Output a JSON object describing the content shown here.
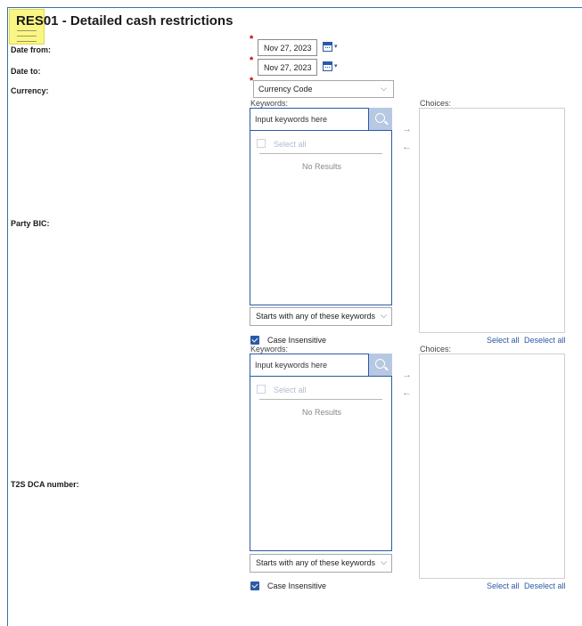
{
  "page": {
    "title": "RES01 - Detailed cash restrictions"
  },
  "fields": {
    "date_from": {
      "label": "Date from:",
      "value": "Nov 27, 2023",
      "required": "*"
    },
    "date_to": {
      "label": "Date to:",
      "value": "Nov 27, 2023",
      "required": "*"
    },
    "currency": {
      "label": "Currency:",
      "value": "Currency Code",
      "required": "*"
    }
  },
  "party_bic": {
    "label": "Party BIC:",
    "keywords_label": "Keywords:",
    "choices_label": "Choices:",
    "search_placeholder": "Input keywords here",
    "select_all_item": "Select all",
    "no_results": "No Results",
    "match_mode": "Starts with any of these keywords",
    "case_insensitive": "Case Insensitive",
    "select_all_link": "Select all",
    "deselect_all_link": "Deselect all",
    "arrow_right": "→",
    "arrow_left": "←"
  },
  "t2s_dca": {
    "label": "T2S DCA number:",
    "keywords_label": "Keywords:",
    "choices_label": "Choices:",
    "search_placeholder": "Input keywords here",
    "select_all_item": "Select all",
    "no_results": "No Results",
    "match_mode": "Starts with any of these keywords",
    "case_insensitive": "Case Insensitive",
    "select_all_link": "Select all",
    "deselect_all_link": "Deselect all",
    "arrow_right": "→",
    "arrow_left": "←"
  },
  "icons": {
    "menu": "menu-icon",
    "calendar": "calendar-icon",
    "search": "search-icon",
    "dropdown": "chevron-down-icon",
    "chevron": "⌵",
    "calendar_caret": "▾"
  },
  "colors": {
    "accent": "#2b59a6",
    "required": "#c00000",
    "highlight": "#faf578"
  }
}
